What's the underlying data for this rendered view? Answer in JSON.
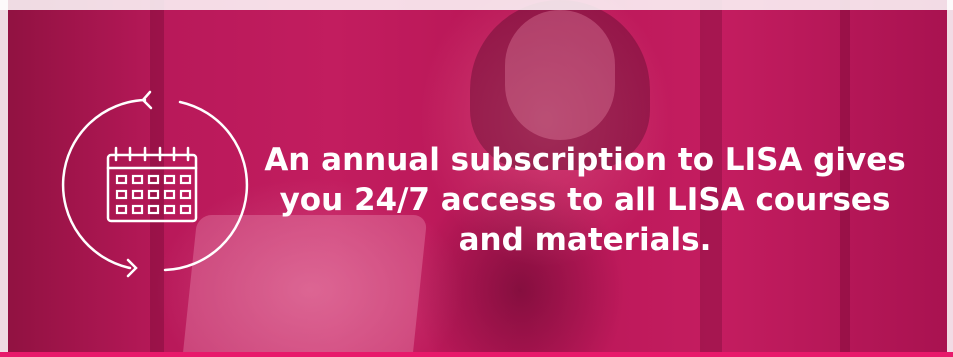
{
  "banner": {
    "headline": "An annual subscription to LISA gives you 24/7 access to all LISA courses and materials.",
    "icon": "calendar-cycle-icon",
    "colors": {
      "overlay": "#b3154e",
      "text": "#ffffff",
      "accent": "#e8196b"
    }
  }
}
